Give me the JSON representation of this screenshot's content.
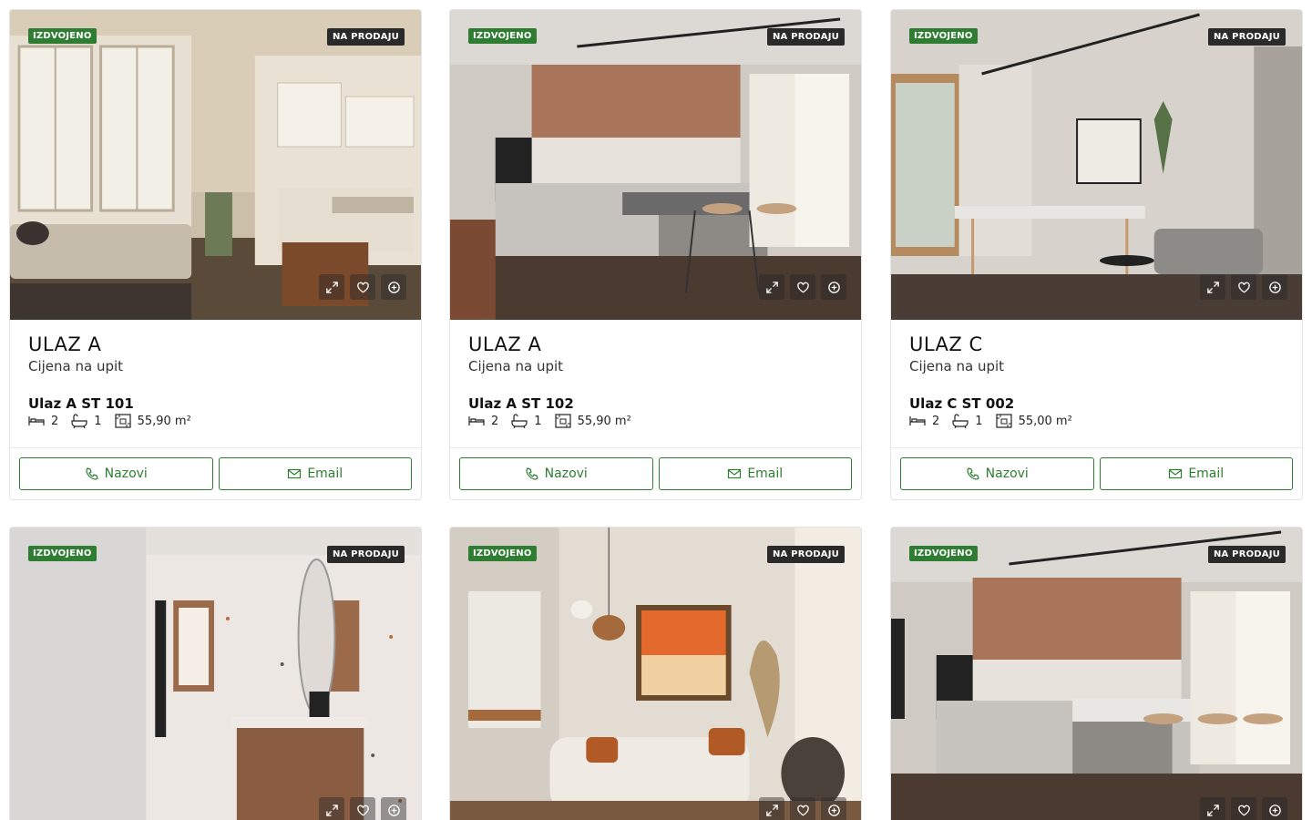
{
  "listings": [
    {
      "featured_label": "IZDVOJENO",
      "status_label": "NA PRODAJU",
      "title": "ULAZ A",
      "price": "Cijena na upit",
      "unit_code": "Ulaz A ST 101",
      "bedrooms": "2",
      "bathrooms": "1",
      "area": "55,90 m²",
      "call_label": "Nazovi",
      "email_label": "Email"
    },
    {
      "featured_label": "IZDVOJENO",
      "status_label": "NA PRODAJU",
      "title": "ULAZ A",
      "price": "Cijena na upit",
      "unit_code": "Ulaz A ST 102",
      "bedrooms": "2",
      "bathrooms": "1",
      "area": "55,90 m²",
      "call_label": "Nazovi",
      "email_label": "Email"
    },
    {
      "featured_label": "IZDVOJENO",
      "status_label": "NA PRODAJU",
      "title": "ULAZ C",
      "price": "Cijena na upit",
      "unit_code": "Ulaz C ST 002",
      "bedrooms": "2",
      "bathrooms": "1",
      "area": "55,00 m²",
      "call_label": "Nazovi",
      "email_label": "Email"
    },
    {
      "featured_label": "IZDVOJENO",
      "status_label": "NA PRODAJU"
    },
    {
      "featured_label": "IZDVOJENO",
      "status_label": "NA PRODAJU"
    },
    {
      "featured_label": "IZDVOJENO",
      "status_label": "NA PRODAJU"
    }
  ],
  "icons": {
    "expand": "expand-icon",
    "favorite": "heart-icon",
    "compare": "plus-circle-icon",
    "bed": "bed-icon",
    "bath": "bath-icon",
    "area": "area-icon",
    "phone": "phone-icon",
    "email": "envelope-icon"
  },
  "colors": {
    "accent": "#2e7d32",
    "status_badge": "#2a2a2a"
  }
}
